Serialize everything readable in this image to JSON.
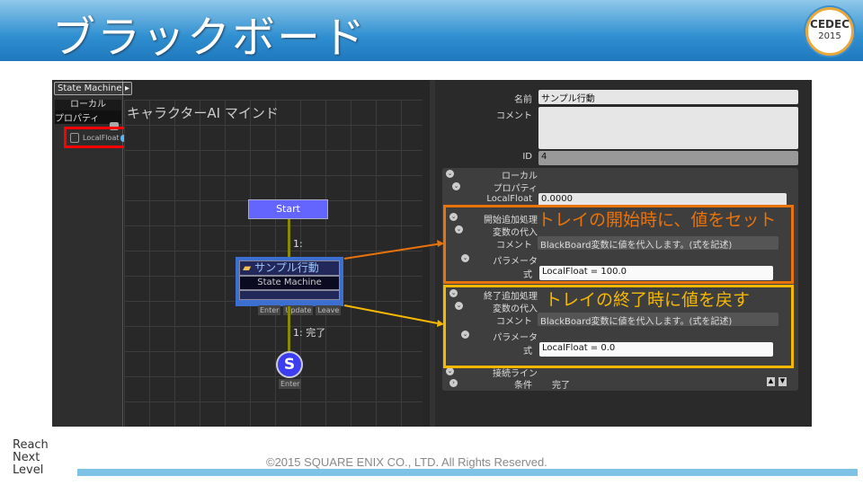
{
  "slide": {
    "title": "ブラックボード",
    "cedec": "CEDEC",
    "cedec_year": "2015",
    "copyright": "©2015 SQUARE ENIX CO., LTD. All Rights Reserved.",
    "logo": [
      "Reach",
      "Next",
      "Level"
    ]
  },
  "toolbar": {
    "state_machine": "State Machine",
    "play": "▸"
  },
  "left_panel": {
    "local": "ローカル",
    "property": "プロパティ",
    "variable": "LocalFloat"
  },
  "canvas": {
    "title": "キャラクターAI マインド",
    "start": "Start",
    "edge1": "1:",
    "node_title": "サンプル行動",
    "node_sub": "State Machine",
    "enter": "Enter",
    "update": "Update",
    "leave": "Leave",
    "edge2": "1: 完了",
    "s": "S",
    "s_enter": "Enter"
  },
  "inspector": {
    "name_label": "名前",
    "name_value": "サンプル行動",
    "comment_label": "コメント",
    "comment_value": "",
    "id_label": "ID",
    "id_value": "4",
    "local": "ローカル",
    "property": "プロパティ",
    "localfloat_label": "LocalFloat",
    "localfloat_value": "0.0000",
    "start_proc": "開始追加処理",
    "assign": "変数の代入",
    "comment": "コメント",
    "comment_text": "BlackBoard変数に値を代入します。(式を記述)",
    "params": "パラメータ",
    "expr": "式",
    "start_expr": "LocalFloat = 100.0",
    "end_proc": "終了追加処理",
    "end_expr": "LocalFloat = 0.0",
    "connect": "接続ライン",
    "cond": "条件",
    "cond_value": "完了"
  },
  "annotations": {
    "start": "トレイの開始時に、値をセット",
    "end": "トレイの終了時に値を戻す",
    "start_color": "#e8730c",
    "end_color": "#f5b800"
  }
}
